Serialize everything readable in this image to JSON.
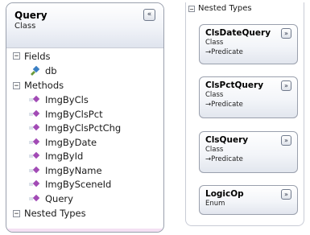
{
  "main_class": {
    "title": "Query",
    "kind": "Class",
    "collapse_glyph": "«",
    "fields_section": {
      "toggle": "−",
      "label": "Fields"
    },
    "fields": [
      {
        "name": "db",
        "icon": "field-icon"
      }
    ],
    "methods_section": {
      "toggle": "−",
      "label": "Methods"
    },
    "methods": [
      {
        "name": "ImgByCls",
        "icon": "method-icon"
      },
      {
        "name": "ImgByClsPct",
        "icon": "method-icon"
      },
      {
        "name": "ImgByClsPctChg",
        "icon": "method-icon"
      },
      {
        "name": "ImgByDate",
        "icon": "method-icon"
      },
      {
        "name": "ImgById",
        "icon": "method-icon"
      },
      {
        "name": "ImgByName",
        "icon": "method-icon"
      },
      {
        "name": "ImgBySceneId",
        "icon": "method-icon"
      },
      {
        "name": "Query",
        "icon": "method-icon"
      }
    ],
    "nested_section": {
      "toggle": "−",
      "label": "Nested Types"
    }
  },
  "nested_panel": {
    "toggle": "−",
    "label": "Nested Types",
    "types": [
      {
        "name": "ClsDateQuery",
        "kind": "Class",
        "base": "→Predicate",
        "expand_glyph": "»"
      },
      {
        "name": "ClsPctQuery",
        "kind": "Class",
        "base": "→Predicate",
        "expand_glyph": "»"
      },
      {
        "name": "ClsQuery",
        "kind": "Class",
        "base": "→Predicate",
        "expand_glyph": "»"
      },
      {
        "name": "LogicOp",
        "kind": "Enum",
        "expand_glyph": "»"
      }
    ]
  },
  "colors": {
    "card_border": "#9aa0ad",
    "method_icon": "#a24bb5",
    "field_icon": "#3a7fc4",
    "accent_pink": "#f4e0f3"
  }
}
